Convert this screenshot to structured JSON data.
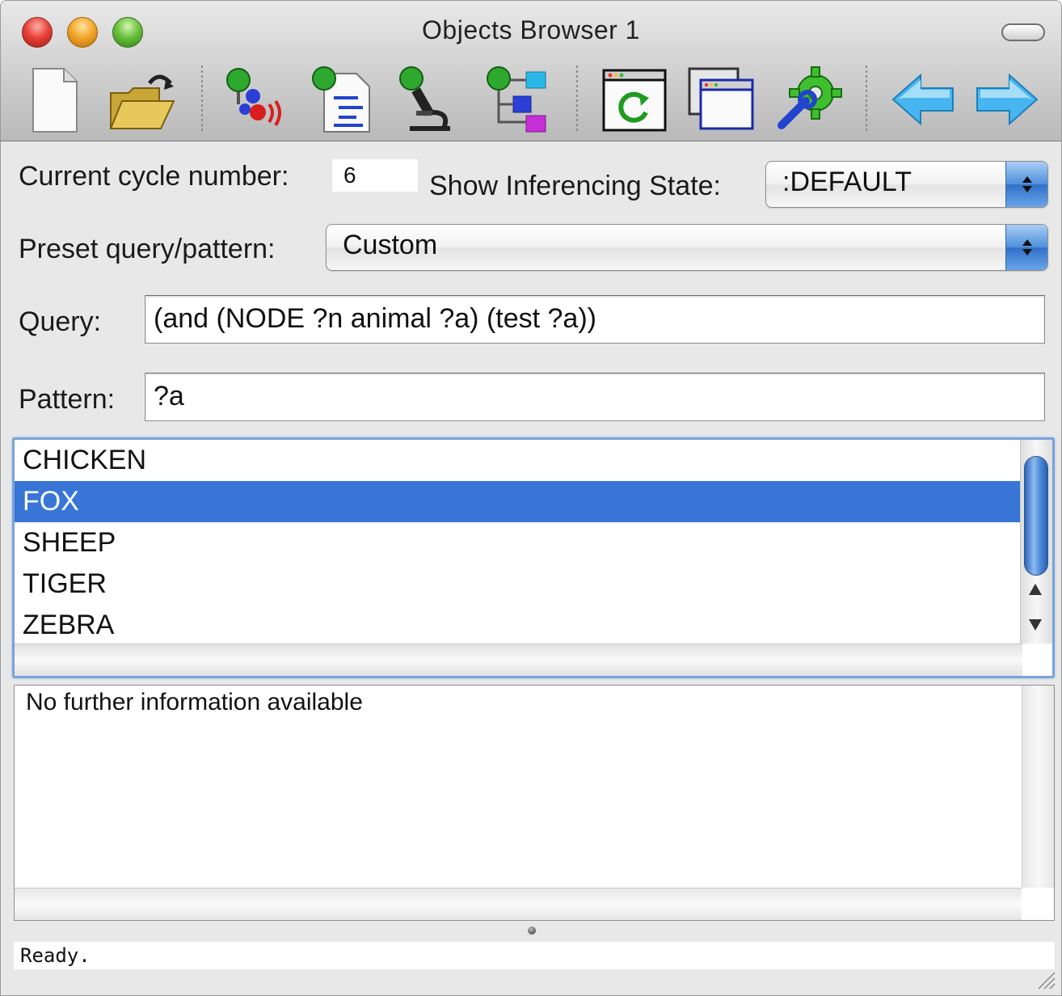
{
  "window": {
    "title": "Objects Browser 1"
  },
  "toolbar": {
    "buttons": [
      {
        "name": "new-document",
        "icon": "blank-page-icon"
      },
      {
        "name": "open-folder",
        "icon": "open-folder-icon"
      },
      {
        "name": "agents",
        "icon": "atoms-broadcast-icon"
      },
      {
        "name": "rules",
        "icon": "node-document-icon"
      },
      {
        "name": "inspect",
        "icon": "microscope-icon"
      },
      {
        "name": "hierarchy",
        "icon": "tree-diagram-icon"
      },
      {
        "name": "refresh-window",
        "icon": "window-refresh-icon"
      },
      {
        "name": "new-window",
        "icon": "stacked-windows-icon"
      },
      {
        "name": "preferences",
        "icon": "gear-wrench-icon"
      },
      {
        "name": "back",
        "icon": "left-arrow-icon"
      },
      {
        "name": "forward",
        "icon": "right-arrow-icon"
      }
    ]
  },
  "form": {
    "cycle_label": "Current cycle number:",
    "cycle_value": "6",
    "inferencing_label": "Show Inferencing State:",
    "inferencing_value": ":DEFAULT",
    "preset_label": "Preset query/pattern:",
    "preset_value": "Custom",
    "query_label": "Query:",
    "query_value": "(and (NODE ?n animal ?a) (test ?a))",
    "pattern_label": "Pattern:",
    "pattern_value": "?a"
  },
  "results": {
    "items": [
      "CHICKEN",
      "FOX",
      "SHEEP",
      "TIGER",
      "ZEBRA"
    ],
    "selected": "FOX"
  },
  "info": {
    "text": "No further information available"
  },
  "status": {
    "text": "Ready."
  },
  "colors": {
    "selection": "#3875d7",
    "focus_ring": "#7aa3d9"
  }
}
